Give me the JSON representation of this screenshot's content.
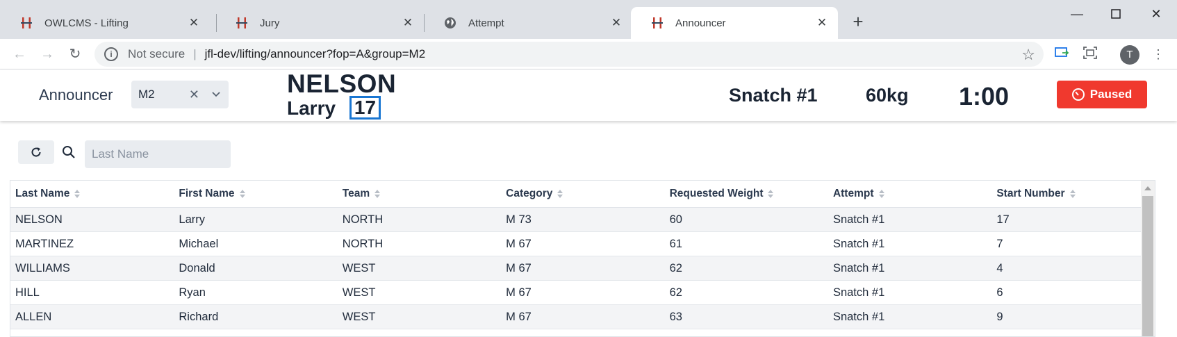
{
  "browser": {
    "tabs": [
      {
        "label": "OWLCMS - Lifting",
        "icon": "owlcms-icon"
      },
      {
        "label": "Jury",
        "icon": "owlcms-icon"
      },
      {
        "label": "Attempt",
        "icon": "globe-icon"
      },
      {
        "label": "Announcer",
        "icon": "owlcms-icon"
      }
    ],
    "address": {
      "security": "Not secure",
      "url": "jfl-dev/lifting/announcer?fop=A&group=M2"
    },
    "profile_initial": "T"
  },
  "header": {
    "title": "Announcer",
    "group": "M2",
    "athlete_last_name": "NELSON",
    "athlete_first_name": "Larry",
    "start_number": "17",
    "attempt": "Snatch #1",
    "weight": "60kg",
    "clock": "1:00",
    "paused_label": "Paused",
    "paused_color": "#f0392e"
  },
  "search": {
    "placeholder": "Last Name"
  },
  "grid": {
    "columns": [
      "Last Name",
      "First Name",
      "Team",
      "Category",
      "Requested Weight",
      "Attempt",
      "Start Number"
    ],
    "rows": [
      [
        "NELSON",
        "Larry",
        "NORTH",
        "M 73",
        "60",
        "Snatch #1",
        "17"
      ],
      [
        "MARTINEZ",
        "Michael",
        "NORTH",
        "M 67",
        "61",
        "Snatch #1",
        "7"
      ],
      [
        "WILLIAMS",
        "Donald",
        "WEST",
        "M 67",
        "62",
        "Snatch #1",
        "4"
      ],
      [
        "HILL",
        "Ryan",
        "WEST",
        "M 67",
        "62",
        "Snatch #1",
        "6"
      ],
      [
        "ALLEN",
        "Richard",
        "WEST",
        "M 67",
        "63",
        "Snatch #1",
        "9"
      ]
    ]
  }
}
